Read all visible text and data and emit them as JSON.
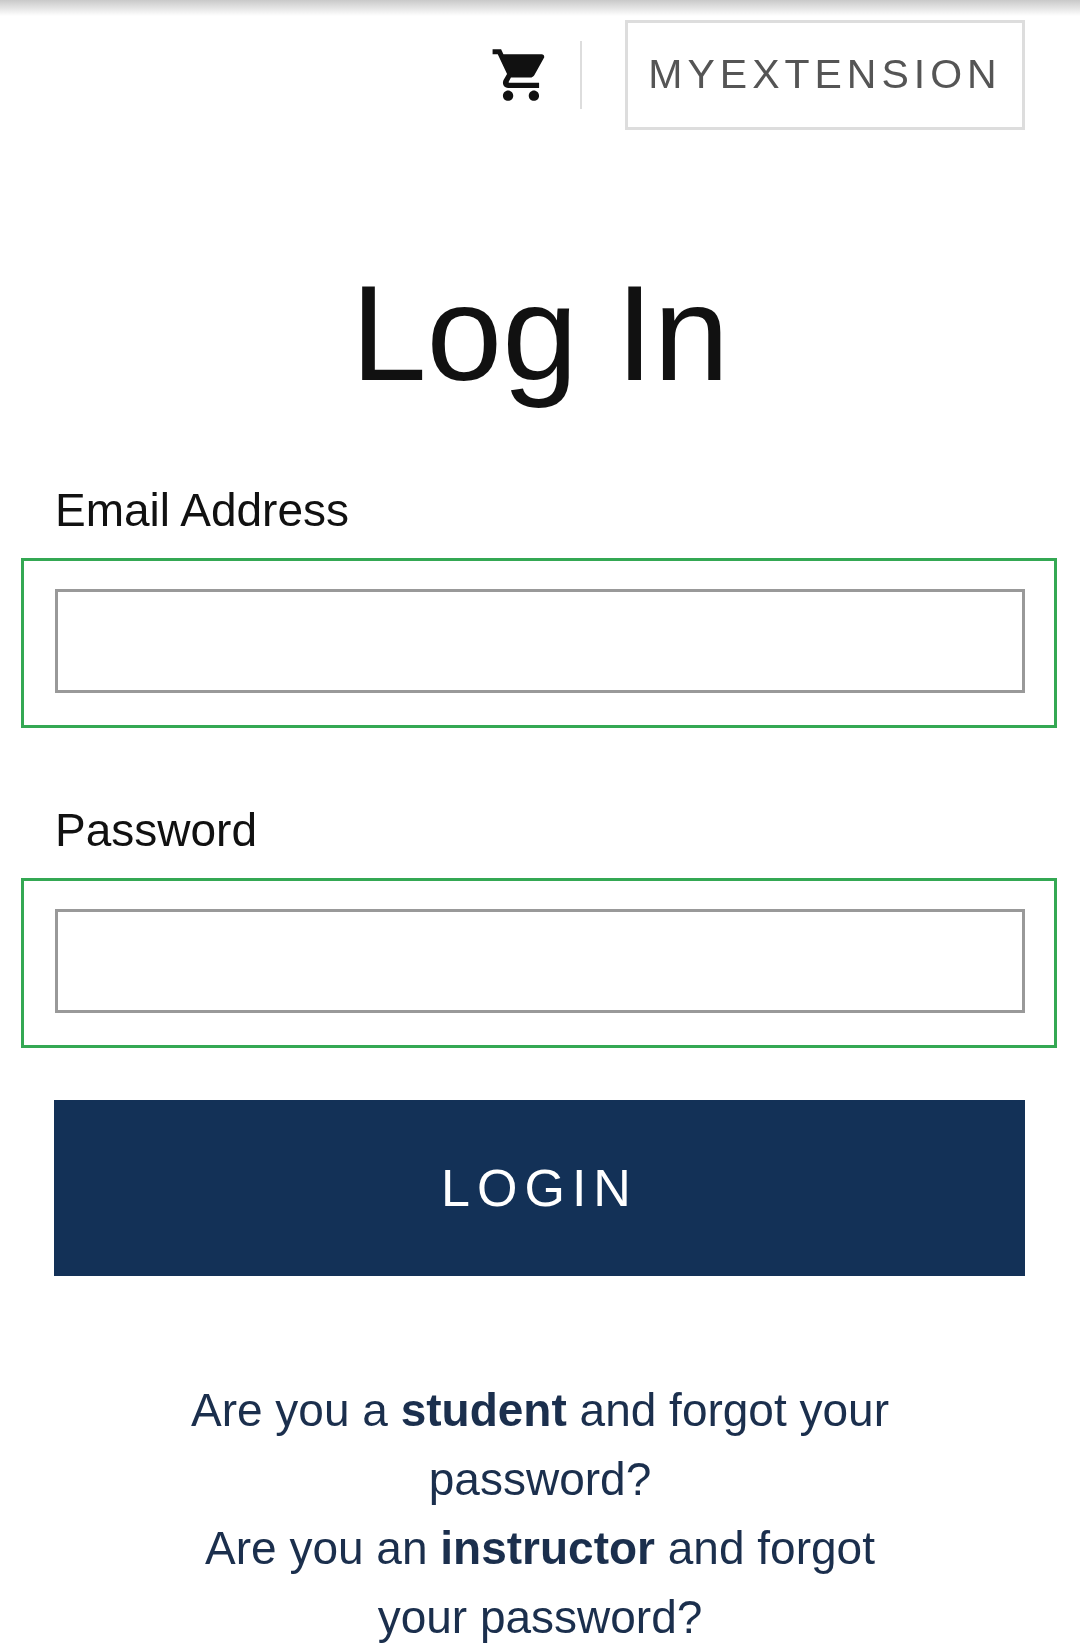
{
  "header": {
    "account_button": "MYEXTENSION"
  },
  "title": "Log In",
  "fields": [
    {
      "label": "Email Address",
      "highlighted": true
    },
    {
      "label": "Password",
      "highlighted": true
    }
  ],
  "login_button": "LOGIN",
  "help_links": [
    "Are you a **student** and forgot your password?",
    "Are you an **instructor** and forgot your password?"
  ]
}
